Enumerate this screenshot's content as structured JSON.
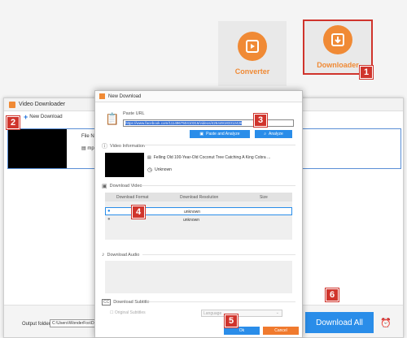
{
  "tiles": {
    "converter": "Converter",
    "downloader": "Downloader"
  },
  "badges": [
    "1",
    "2",
    "3",
    "4",
    "5",
    "6"
  ],
  "main_window": {
    "title": "Video Downloader",
    "new_download": "New Download",
    "file_name_prefix": "File Nar",
    "format_prefix": "mp",
    "output_label": "Output folder:",
    "output_value": "C:\\Users\\WonderFox\\Documents",
    "download_all": "Download All"
  },
  "dialog": {
    "title": "New Download",
    "paste_url_label": "Paste URL",
    "url_value": "https://www.facebook.com/111496750410316/videos/426449183312426",
    "paste_analyze": "Paste and Analyze",
    "analyze": "Analyze",
    "video_info": "Video Information",
    "video_title": "Felling Old 100-Year-Old Coconut Tree Catching A King Cobra ...",
    "duration": "Unknown",
    "download_video": "Download Video",
    "col_format": "Download Format",
    "col_resolution": "Download Resolution",
    "col_size": "Size",
    "rows": [
      {
        "res": "unknown"
      },
      {
        "res": "unknown"
      }
    ],
    "download_audio": "Download Audio",
    "download_subtitle": "Download Subtitle",
    "original_subtitles": "Original Subtitles",
    "language": "Language",
    "ok": "Ok",
    "cancel": "Cancel"
  },
  "colors": {
    "accent": "#f08a35",
    "blue": "#2a8de9",
    "badge": "#d0342c"
  }
}
